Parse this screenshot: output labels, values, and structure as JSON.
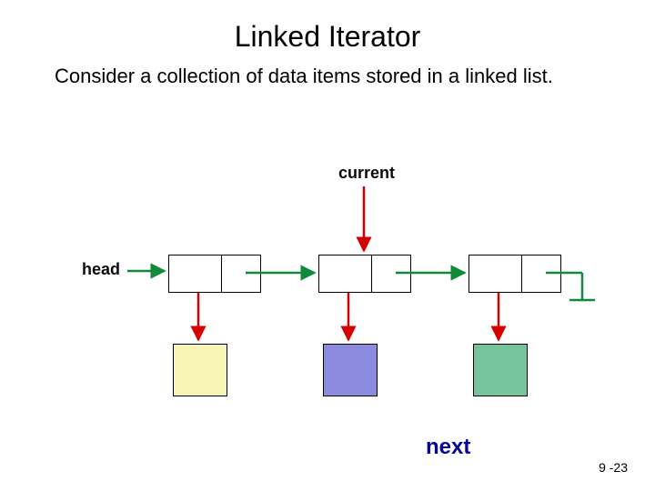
{
  "title": "Linked Iterator",
  "description": "Consider a collection of data items stored in a linked list.",
  "labels": {
    "current": "current",
    "head": "head",
    "next": "next"
  },
  "slide_number": "9 -23",
  "diagram": {
    "nodes": [
      {
        "id": "node1",
        "data_color": "#f8f6b6"
      },
      {
        "id": "node2",
        "data_color": "#8b8be0"
      },
      {
        "id": "node3",
        "data_color": "#76c49c"
      }
    ],
    "pointers": {
      "head_to": "node1",
      "current_to": "node2",
      "links": [
        {
          "from": "node1",
          "to": "node2"
        },
        {
          "from": "node2",
          "to": "node3"
        },
        {
          "from": "node3",
          "to": "null"
        }
      ],
      "data_links": [
        {
          "from": "node1",
          "to": "data1"
        },
        {
          "from": "node2",
          "to": "data2"
        },
        {
          "from": "node3",
          "to": "data3"
        }
      ]
    }
  }
}
